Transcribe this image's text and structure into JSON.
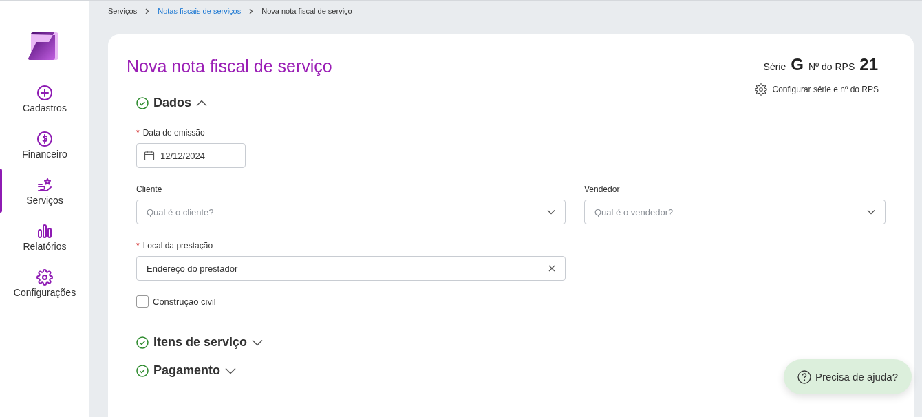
{
  "sidebar": {
    "items": [
      {
        "label": "Cadastros",
        "kind": "plus",
        "selected": false
      },
      {
        "label": "Financeiro",
        "kind": "money",
        "selected": false
      },
      {
        "label": "Serviços",
        "kind": "service",
        "selected": true
      },
      {
        "label": "Relatórios",
        "kind": "chart",
        "selected": false
      },
      {
        "label": "Configurações",
        "kind": "gear",
        "selected": false
      }
    ]
  },
  "breadcrumb": [
    {
      "label": "Serviços",
      "link": false
    },
    {
      "label": "Notas fiscais de serviços",
      "link": true
    },
    {
      "label": "Nova nota fiscal de serviço",
      "link": false
    }
  ],
  "page_title": "Nova nota fiscal de serviço",
  "serie": {
    "label": "Série",
    "value": "G"
  },
  "rps": {
    "label": "Nº do RPS",
    "value": "21"
  },
  "config_link": "Configurar série e nº do RPS",
  "sections": [
    {
      "title": "Dados",
      "expanded": true,
      "complete": true
    },
    {
      "title": "Itens de serviço",
      "expanded": false,
      "complete": true
    },
    {
      "title": "Pagamento",
      "expanded": false,
      "complete": true
    }
  ],
  "form": {
    "date": {
      "label": "Data de emissão",
      "required_mark": "*",
      "value": "12/12/2024"
    },
    "cliente": {
      "label": "Cliente",
      "placeholder": "Qual é o cliente?"
    },
    "vendedor": {
      "label": "Vendedor",
      "placeholder": "Qual é o vendedor?"
    },
    "local": {
      "label": "Local da prestação",
      "required_mark": "*",
      "value": "Endereço do prestador"
    },
    "construcao": {
      "label": "Construção civil",
      "checked": false
    }
  },
  "help_button": "Precisa de ajuda?"
}
